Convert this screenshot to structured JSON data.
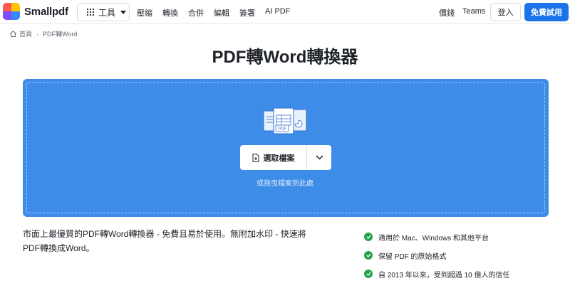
{
  "brand": {
    "name": "Smallpdf",
    "logo_colors": [
      "#ff5a4f",
      "#ffc300",
      "#3a86ff",
      "#7c4dff"
    ]
  },
  "header": {
    "tools_label": "工具",
    "nav": [
      "壓縮",
      "轉換",
      "合併",
      "編輯",
      "簽署",
      "AI PDF"
    ],
    "pricing_label": "價錢",
    "teams_label": "Teams",
    "login_label": "登入",
    "trial_label": "免費試用"
  },
  "breadcrumb": {
    "home_label": "首頁",
    "current_label": "PDF轉Word"
  },
  "title": "PDF轉Word轉換器",
  "dropzone": {
    "choose_label": "選取檔案",
    "hint": "或拖曳檔案到此處",
    "badge": "PDF"
  },
  "description": "市面上最優質的PDF轉Word轉換器 - 免費且易於使用。無附加水印 - 快速將PDF轉換成Word。",
  "features": [
    "適用於 Mac、Windows 和其他平台",
    "保留 PDF 的原始格式",
    "自 2013 年以來，受到超過 10 億人的信任"
  ],
  "colors": {
    "accent": "#1a73e8",
    "dropzone": "#3d8de8",
    "check": "#21a24b"
  }
}
